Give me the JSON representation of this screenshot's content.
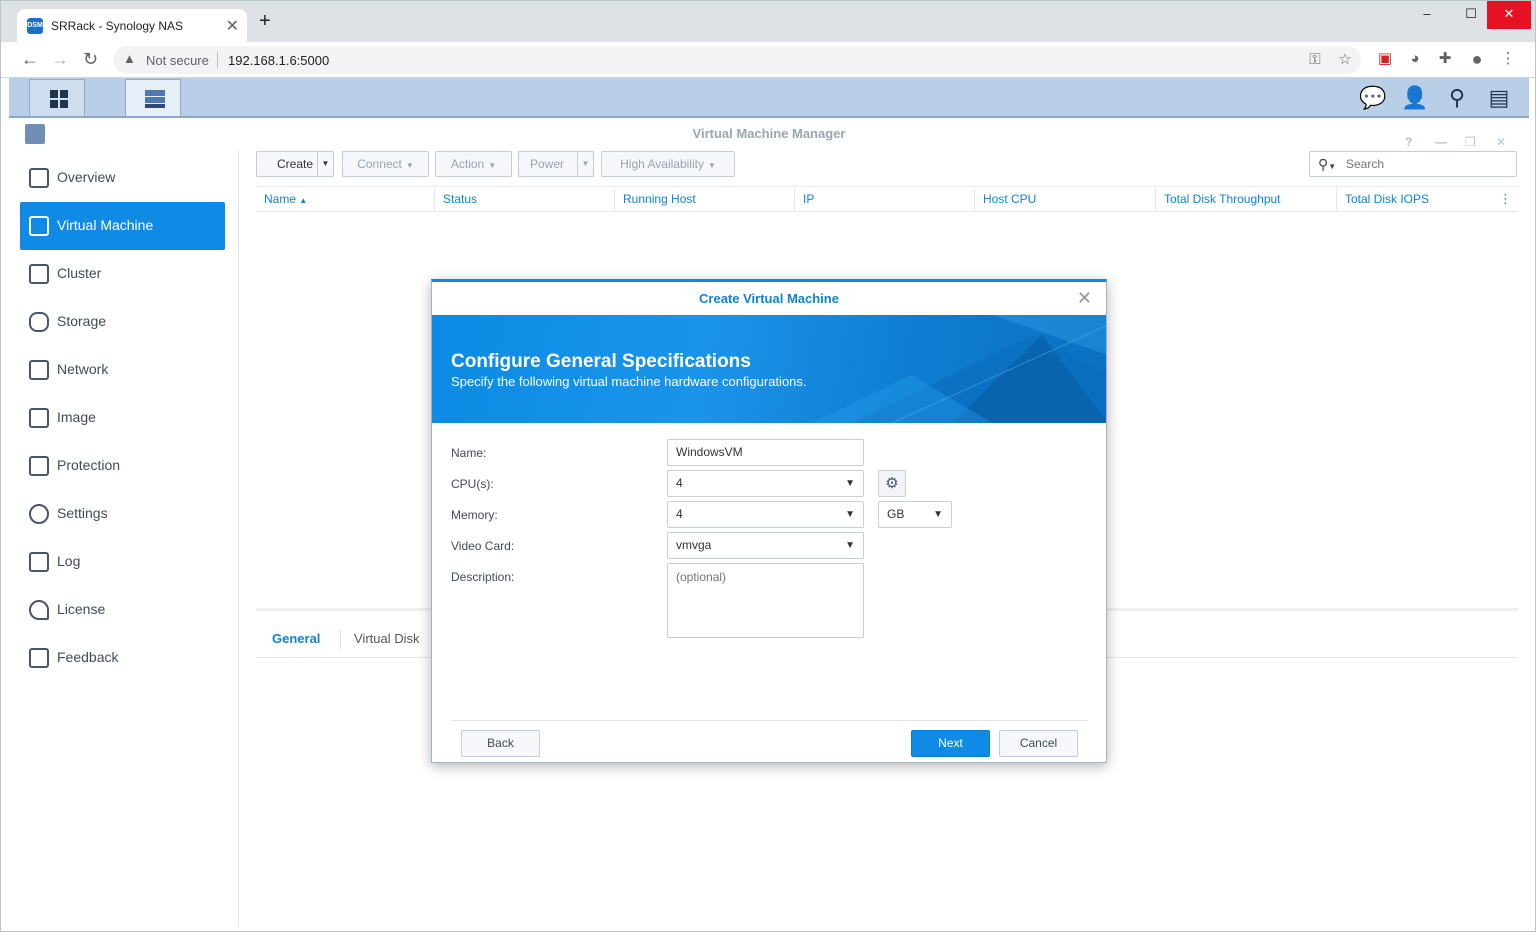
{
  "browser": {
    "tab_title": "SRRack - Synology NAS",
    "favicon_text": "DSM",
    "security_label": "Not secure",
    "url": "192.168.1.6:5000"
  },
  "app": {
    "title": "Virtual Machine Manager"
  },
  "sidebar": {
    "items": [
      {
        "label": "Overview",
        "icon": "overview-icon"
      },
      {
        "label": "Virtual Machine",
        "icon": "virtual-machine-icon",
        "active": true
      },
      {
        "label": "Cluster",
        "icon": "cluster-icon"
      },
      {
        "label": "Storage",
        "icon": "storage-icon"
      },
      {
        "label": "Network",
        "icon": "network-icon"
      },
      {
        "label": "Image",
        "icon": "image-icon"
      },
      {
        "label": "Protection",
        "icon": "protection-icon"
      },
      {
        "label": "Settings",
        "icon": "gear-icon"
      },
      {
        "label": "Log",
        "icon": "log-icon"
      },
      {
        "label": "License",
        "icon": "key-icon"
      },
      {
        "label": "Feedback",
        "icon": "mail-icon"
      }
    ]
  },
  "toolbar": {
    "create": "Create",
    "connect": "Connect",
    "action": "Action",
    "power": "Power",
    "high_availability": "High Availability",
    "search_placeholder": "Search"
  },
  "grid": {
    "columns": [
      "Name",
      "Status",
      "Running Host",
      "IP",
      "Host CPU",
      "Total Disk Throughput",
      "Total Disk IOPS"
    ]
  },
  "bottom_tabs": {
    "general": "General",
    "virtual_disk": "Virtual Disk"
  },
  "modal": {
    "title": "Create Virtual Machine",
    "heading": "Configure General Specifications",
    "subheading": "Specify the following virtual machine hardware configurations.",
    "fields": {
      "name_label": "Name:",
      "name_value": "WindowsVM",
      "cpu_label": "CPU(s):",
      "cpu_value": "4",
      "memory_label": "Memory:",
      "memory_value": "4",
      "memory_unit": "GB",
      "video_label": "Video Card:",
      "video_value": "vmvga",
      "description_label": "Description:",
      "description_placeholder": "(optional)"
    },
    "buttons": {
      "back": "Back",
      "next": "Next",
      "cancel": "Cancel"
    }
  },
  "colors": {
    "accent": "#0f8be6",
    "link": "#0e83d4"
  }
}
